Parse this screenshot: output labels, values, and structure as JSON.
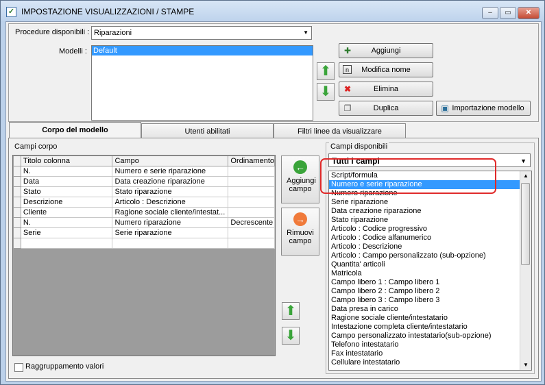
{
  "window": {
    "title": "IMPOSTAZIONE VISUALIZZAZIONI / STAMPE",
    "buttons": [
      "minimize",
      "maximize",
      "close"
    ]
  },
  "top": {
    "procedure_label": "Procedure disponibili :",
    "procedure_value": "Riparazioni",
    "modelli_label": "Modelli :",
    "modelli_items": [
      "Default"
    ],
    "buttons": {
      "aggiungi": "Aggiungi",
      "modifica": "Modifica nome",
      "elimina": "Elimina",
      "duplica": "Duplica",
      "importazione": "Importazione modello"
    }
  },
  "tabs": [
    {
      "label": "Corpo del modello"
    },
    {
      "label": "Utenti abilitati"
    },
    {
      "label": "Filtri linee da visualizzare"
    }
  ],
  "corpo": {
    "group_label": "Campi corpo",
    "columns": [
      "Titolo colonna",
      "Campo",
      "Ordinamento"
    ],
    "rows": [
      {
        "titolo": "N.",
        "campo": "Numero e serie riparazione",
        "ordinamento": ""
      },
      {
        "titolo": "Data",
        "campo": "Data creazione riparazione",
        "ordinamento": ""
      },
      {
        "titolo": "Stato",
        "campo": "Stato riparazione",
        "ordinamento": ""
      },
      {
        "titolo": "Descrizione",
        "campo": "Articolo : Descrizione",
        "ordinamento": ""
      },
      {
        "titolo": "Cliente",
        "campo": "Ragione sociale cliente/intestat...",
        "ordinamento": ""
      },
      {
        "titolo": "N.",
        "campo": "Numero riparazione",
        "ordinamento": "Decrescente"
      },
      {
        "titolo": "Serie",
        "campo": "Serie riparazione",
        "ordinamento": ""
      },
      {
        "titolo": "",
        "campo": "",
        "ordinamento": ""
      }
    ],
    "aggiungi_campo": "Aggiungi campo",
    "rimuovi_campo": "Rimuovi campo",
    "raggruppamento": "Raggruppamento valori"
  },
  "disponibili": {
    "group_label": "Campi disponibili",
    "filter_value": "Tutti i campi",
    "items": [
      "Script/formula",
      "Numero e serie riparazione",
      "Numero riparazione",
      "Serie riparazione",
      "Data creazione riparazione",
      "Stato riparazione",
      "Articolo : Codice progressivo",
      "Articolo : Codice alfanumerico",
      "Articolo : Descrizione",
      "Articolo : Campo personalizzato (sub-opzione)",
      "Quantita' articoli",
      "Matricola",
      "Campo libero 1 : Campo libero 1",
      "Campo libero 2 : Campo libero 2",
      "Campo libero 3 : Campo libero 3",
      "Data presa in carico",
      "Ragione sociale cliente/intestatario",
      "Intestazione completa cliente/intestatario",
      "Campo personalizzato intestatario(sub-opzione)",
      "Telefono intestatario",
      "Fax intestatario",
      "Cellulare intestatario"
    ],
    "selected_index": 1
  },
  "colors": {
    "selection": "#3399ff",
    "highlight": "#e02a2a",
    "arrow_green": "#3aa43a"
  }
}
